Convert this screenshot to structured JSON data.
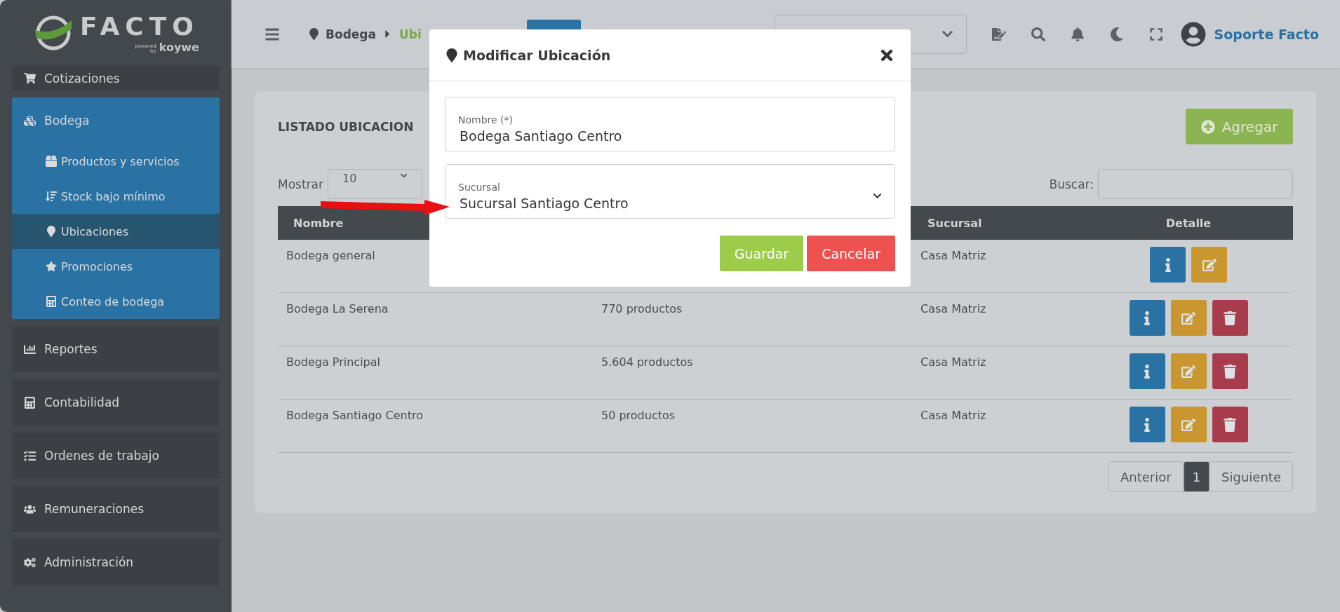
{
  "logo": {
    "name": "FACTO",
    "powered": "powered",
    "by": "by",
    "brand": "koywe"
  },
  "sidebar": {
    "items": [
      {
        "label": "Cotizaciones",
        "expanded": false
      },
      {
        "label": "Bodega",
        "expanded": true,
        "children": [
          {
            "label": "Productos y servicios",
            "selected": false
          },
          {
            "label": "Stock bajo mínimo",
            "selected": false
          },
          {
            "label": "Ubicaciones",
            "selected": true
          },
          {
            "label": "Promociones",
            "selected": false
          },
          {
            "label": "Conteo de bodega",
            "selected": false
          }
        ]
      },
      {
        "label": "Reportes",
        "expanded": false
      },
      {
        "label": "Contabilidad",
        "expanded": false
      },
      {
        "label": "Ordenes de trabajo",
        "expanded": false
      },
      {
        "label": "Remuneraciones",
        "expanded": false
      },
      {
        "label": "Administración",
        "expanded": false
      }
    ]
  },
  "header": {
    "breadcrumb": [
      "Bodega",
      "Ubi"
    ],
    "user": "Soporte Facto"
  },
  "card": {
    "title": "LISTADO UBICACION",
    "add_button": "Agregar",
    "show_label": "Mostrar",
    "show_value": "10",
    "search_label": "Buscar:",
    "table": {
      "header": {
        "column_1": "Nombre",
        "column_3": "Sucursal",
        "column_4": "Detalle"
      },
      "rows": [
        {
          "nombre": "Bodega general",
          "sucursal": "Casa Matriz",
          "actions": [
            {
              "kind": "info"
            },
            {
              "kind": "edit"
            }
          ]
        },
        {
          "nombre": "Bodega La Serena",
          "column_2": "770 productos",
          "sucursal": "Casa Matriz",
          "actions": [
            {
              "kind": "info"
            },
            {
              "kind": "edit"
            },
            {
              "kind": "delete"
            }
          ]
        },
        {
          "nombre": "Bodega Principal",
          "column_2": "5.604 productos",
          "sucursal": "Casa Matriz",
          "actions": [
            {
              "kind": "info"
            },
            {
              "kind": "edit"
            },
            {
              "kind": "delete"
            }
          ]
        },
        {
          "nombre": "Bodega Santiago Centro",
          "column_2": "50 productos",
          "sucursal": "Casa Matriz",
          "actions": [
            {
              "kind": "info"
            },
            {
              "kind": "edit"
            },
            {
              "kind": "delete"
            }
          ]
        }
      ]
    },
    "pagination": {
      "previous": "Anterior",
      "pages": [
        {
          "label": "1",
          "selected": true
        }
      ],
      "next": "Siguiente"
    }
  },
  "modal": {
    "title": "Modificar Ubicación",
    "fields": [
      {
        "kind": "text",
        "label": "Nombre (*)",
        "value": "Bodega Santiago Centro"
      },
      {
        "kind": "select",
        "label": "Sucursal",
        "value": "Sucursal Santiago Centro"
      }
    ],
    "buttons": [
      {
        "kind": "primary",
        "label": "Guardar"
      },
      {
        "kind": "danger",
        "label": "Cancelar"
      }
    ]
  }
}
